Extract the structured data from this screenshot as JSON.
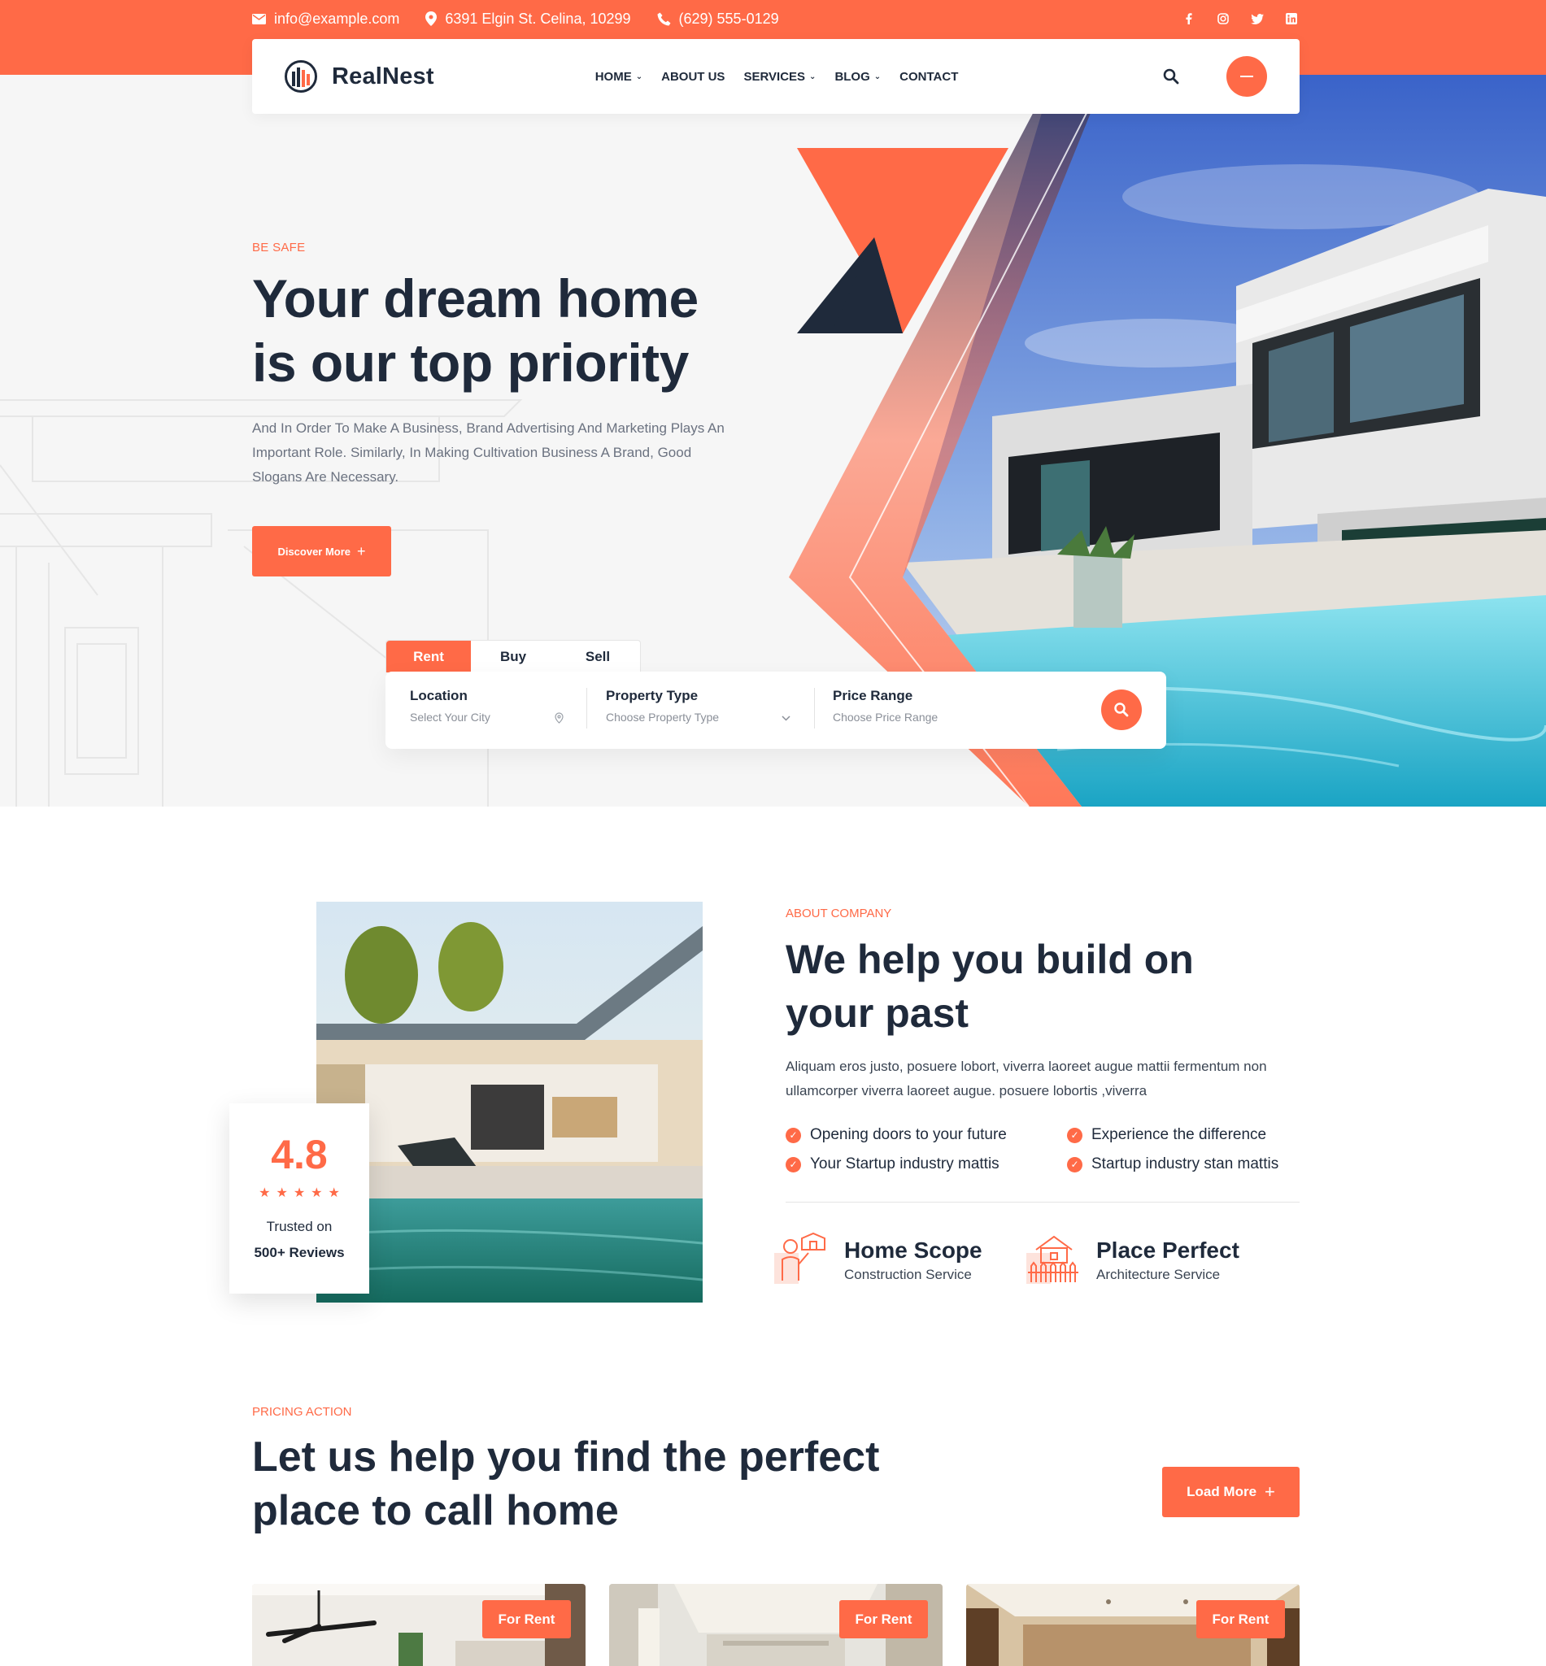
{
  "topbar": {
    "email": "info@example.com",
    "address": "6391 Elgin St. Celina, 10299",
    "phone": "(629) 555-0129",
    "social_icons": [
      "facebook-icon",
      "instagram-icon",
      "twitter-icon",
      "linkedin-icon"
    ]
  },
  "header": {
    "logo_text": "RealNest",
    "nav": [
      {
        "label": "HOME",
        "dropdown": true
      },
      {
        "label": "ABOUT US",
        "dropdown": false
      },
      {
        "label": "SERVICES",
        "dropdown": true
      },
      {
        "label": "BLOG",
        "dropdown": true
      },
      {
        "label": "CONTACT",
        "dropdown": false
      }
    ]
  },
  "hero": {
    "eyebrow": "BE SAFE",
    "title": "Your dream home is our top priority",
    "text": "And In Order To Make A Business, Brand Advertising And Marketing Plays An Important Role. Similarly, In Making Cultivation Business A Brand, Good Slogans Are Necessary.",
    "button": "Discover More"
  },
  "search": {
    "tabs": [
      "Rent",
      "Buy",
      "Sell"
    ],
    "active_tab": "Rent",
    "fields": [
      {
        "label": "Location",
        "placeholder": "Select Your City"
      },
      {
        "label": "Property Type",
        "placeholder": "Choose Property Type"
      },
      {
        "label": "Price Range",
        "placeholder": "Choose Price Range"
      }
    ]
  },
  "about": {
    "eyebrow": "ABOUT COMPANY",
    "title": "We help you build on your past",
    "text": "Aliquam eros justo, posuere lobort, viverra laoreet augue mattii fermentum non ullamcorper viverra laoreet augue. posuere lobortis ,viverra",
    "checks": [
      "Opening doors to your future",
      "Experience the difference",
      "Your Startup industry mattis",
      "Startup industry stan mattis"
    ],
    "rating": {
      "value": "4.8",
      "stars": 5,
      "line1": "Trusted on",
      "line2": "500+ Reviews"
    },
    "services": [
      {
        "title": "Home Scope",
        "subtitle": "Construction Service"
      },
      {
        "title": "Place Perfect",
        "subtitle": "Architecture Service"
      }
    ]
  },
  "pricing": {
    "eyebrow": "PRICING ACTION",
    "title": "Let us help you find the perfect place to call home",
    "button": "Load More",
    "cards": [
      {
        "badge": "For Rent"
      },
      {
        "badge": "For Rent"
      },
      {
        "badge": "For Rent"
      }
    ]
  },
  "colors": {
    "accent": "#ff6a47",
    "dark": "#1f2a3b",
    "text_muted": "#6b7280"
  }
}
